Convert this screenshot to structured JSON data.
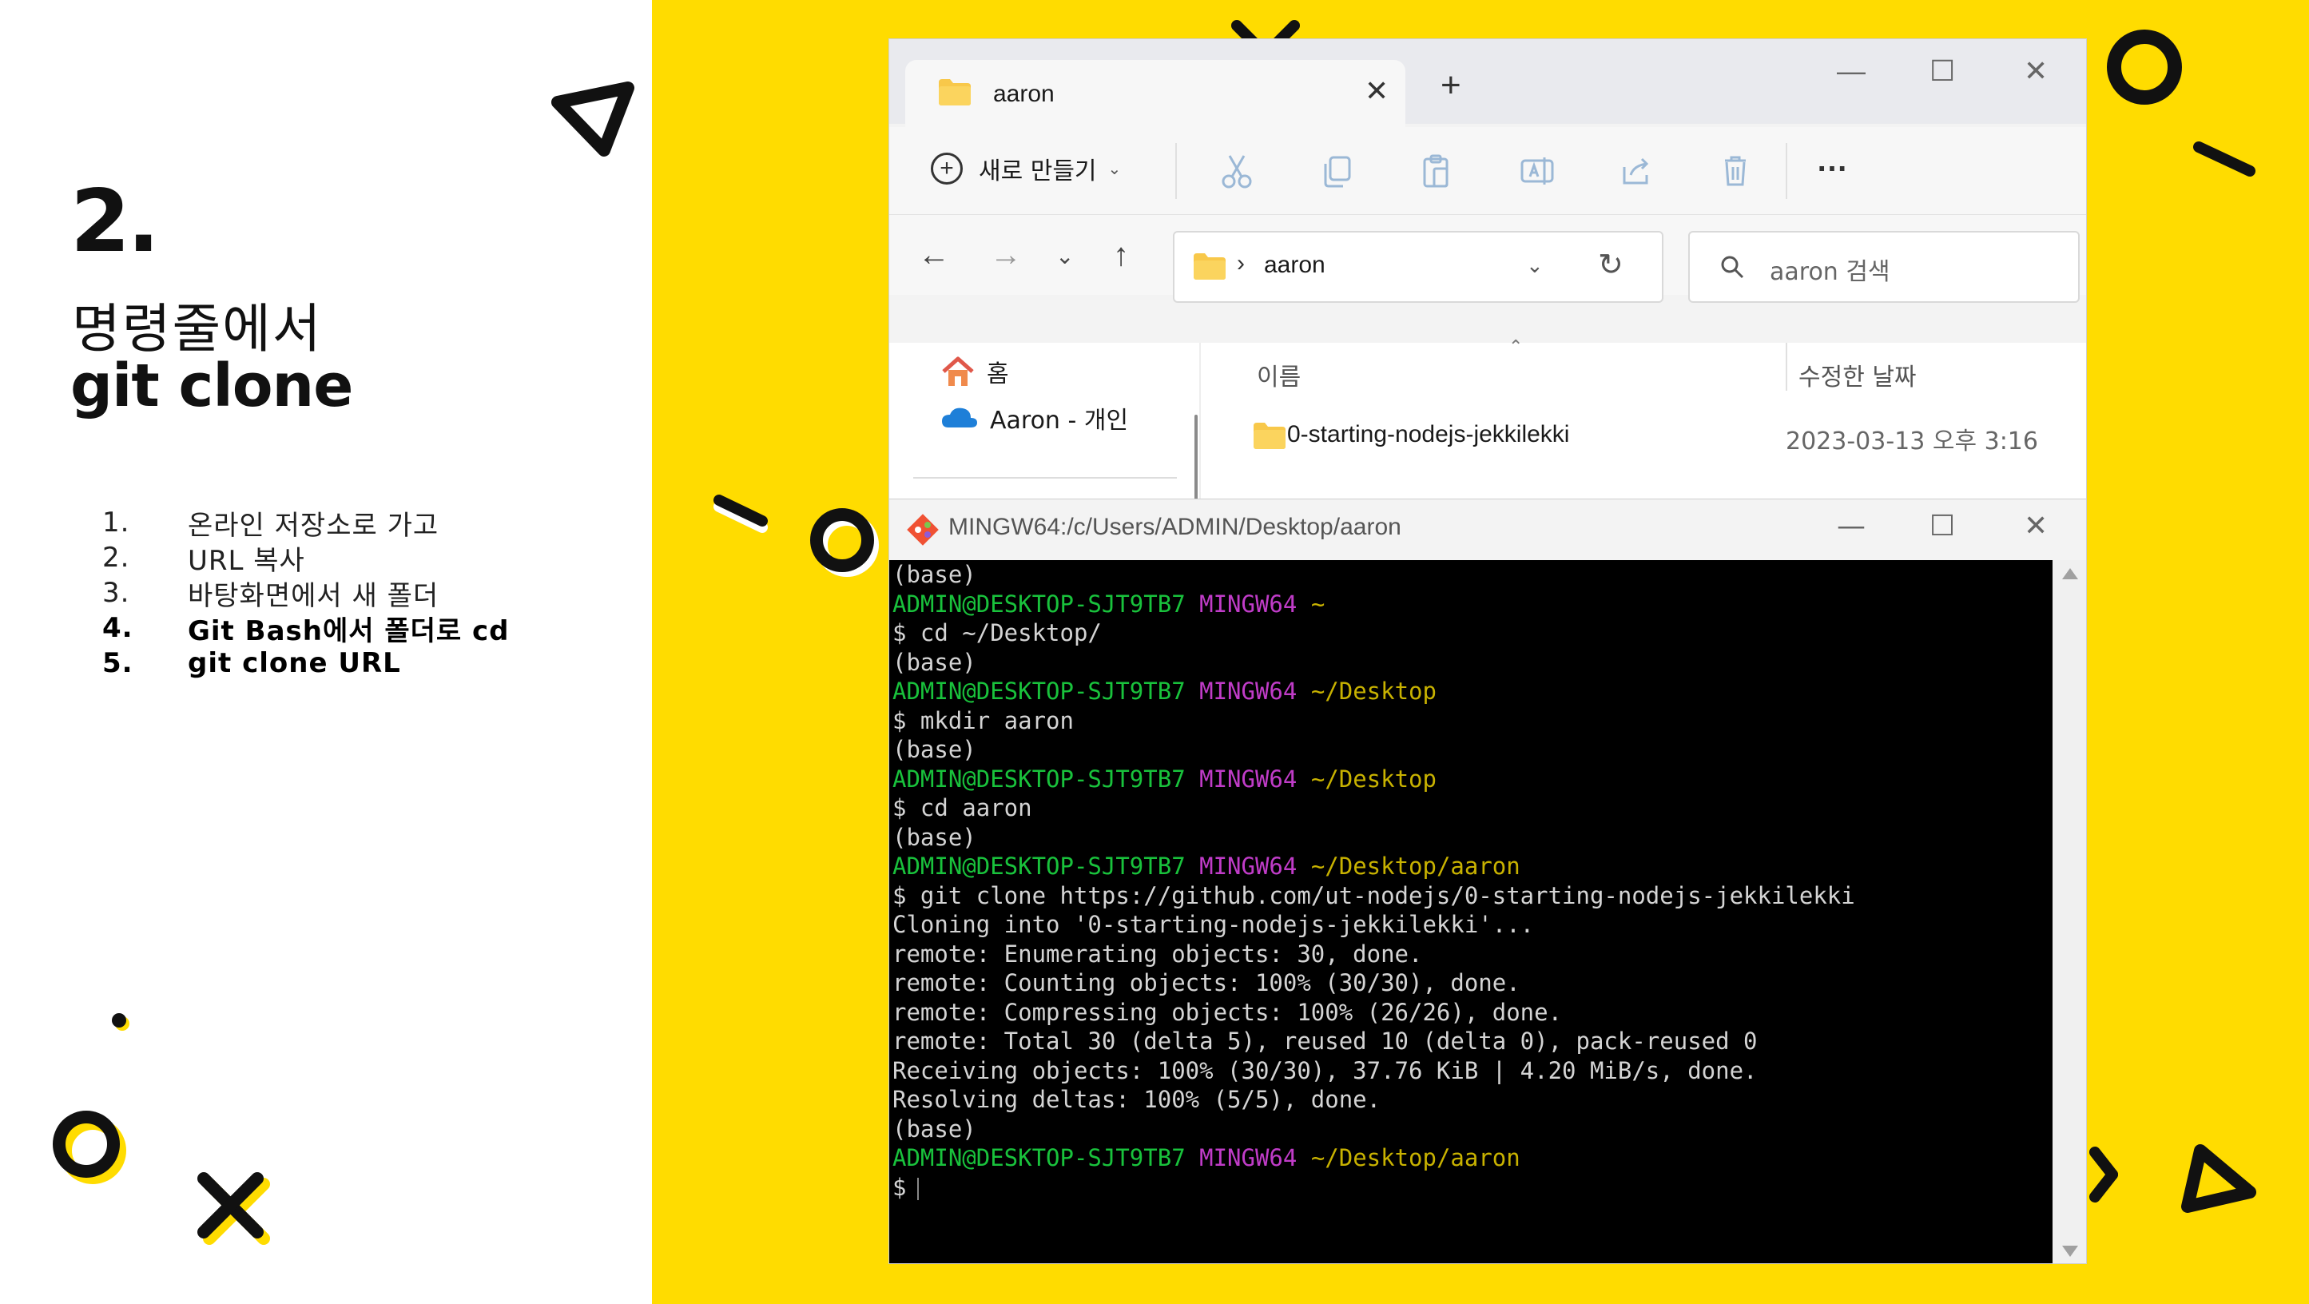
{
  "slide": {
    "number": "2.",
    "subtitle": "명령줄에서",
    "title": "git clone",
    "steps": [
      {
        "num": "1.",
        "label": "온라인 저장소로 가고",
        "bold": false
      },
      {
        "num": "2.",
        "label": "URL 복사",
        "bold": false
      },
      {
        "num": "3.",
        "label": "바탕화면에서 새 폴더",
        "bold": false
      },
      {
        "num": "4.",
        "label": "Git Bash에서 폴더로 cd",
        "bold": true
      },
      {
        "num": "5.",
        "label": "git clone URL",
        "bold": true
      }
    ],
    "colors": {
      "accent": "#FFDC00",
      "text": "#111111"
    }
  },
  "explorer": {
    "tab_label": "aaron",
    "new_button_label": "새로 만들기",
    "address": {
      "path": "aaron"
    },
    "search_placeholder": "aaron 검색",
    "sidebar": {
      "home": "홈",
      "onedrive": "Aaron - 개인"
    },
    "columns": {
      "name": "이름",
      "date": "수정한 날짜"
    },
    "files": [
      {
        "name": "0-starting-nodejs-jekkilekki",
        "date": "2023-03-13 오후 3:16"
      }
    ]
  },
  "terminal": {
    "title": "MINGW64:/c/Users/ADMIN/Desktop/aaron",
    "user_host": "ADMIN@DESKTOP-SJT9TB7",
    "shell": "MINGW64",
    "lines": [
      {
        "type": "text",
        "text": "(base)"
      },
      {
        "type": "prompt",
        "path": "~"
      },
      {
        "type": "text",
        "text": "$ cd ~/Desktop/"
      },
      {
        "type": "text",
        "text": "(base)"
      },
      {
        "type": "prompt",
        "path": "~/Desktop"
      },
      {
        "type": "text",
        "text": "$ mkdir aaron"
      },
      {
        "type": "text",
        "text": "(base)"
      },
      {
        "type": "prompt",
        "path": "~/Desktop"
      },
      {
        "type": "text",
        "text": "$ cd aaron"
      },
      {
        "type": "text",
        "text": "(base)"
      },
      {
        "type": "prompt",
        "path": "~/Desktop/aaron"
      },
      {
        "type": "text",
        "text": "$ git clone https://github.com/ut-nodejs/0-starting-nodejs-jekkilekki"
      },
      {
        "type": "text",
        "text": "Cloning into '0-starting-nodejs-jekkilekki'..."
      },
      {
        "type": "text",
        "text": "remote: Enumerating objects: 30, done."
      },
      {
        "type": "text",
        "text": "remote: Counting objects: 100% (30/30), done."
      },
      {
        "type": "text",
        "text": "remote: Compressing objects: 100% (26/26), done."
      },
      {
        "type": "text",
        "text": "remote: Total 30 (delta 5), reused 10 (delta 0), pack-reused 0"
      },
      {
        "type": "text",
        "text": "Receiving objects: 100% (30/30), 37.76 KiB | 4.20 MiB/s, done."
      },
      {
        "type": "text",
        "text": "Resolving deltas: 100% (5/5), done."
      },
      {
        "type": "text",
        "text": "(base)"
      },
      {
        "type": "prompt",
        "path": "~/Desktop/aaron"
      },
      {
        "type": "cursor",
        "text": "$"
      }
    ]
  }
}
